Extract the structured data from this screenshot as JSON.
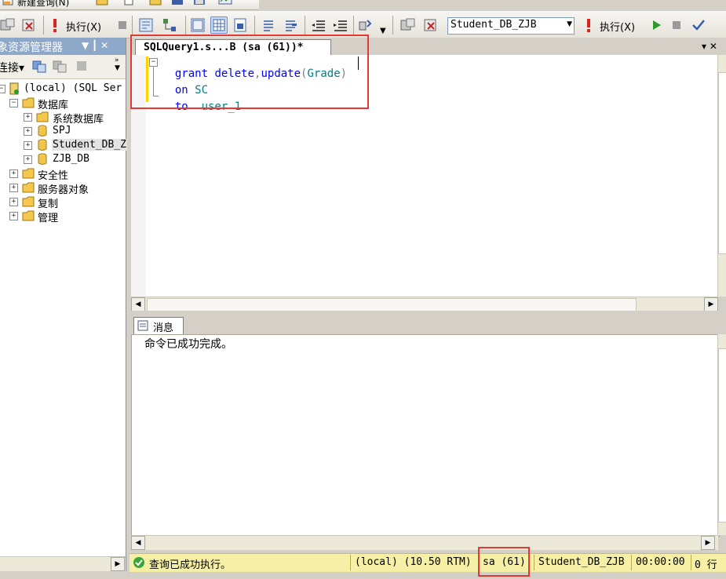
{
  "toolbar_top": {
    "new_query_label": "新建查询(N)"
  },
  "toolbar_main": {
    "execute_label_left": "执行(X)",
    "database_select_value": "Student_DB_ZJB",
    "execute_label_right": "执行(X)"
  },
  "object_explorer": {
    "title": "象资源管理器",
    "title_pin": "▼ ┃ ✕",
    "connect_label": "连接▾",
    "tree": [
      {
        "label": "(local) (SQL Ser",
        "level": 0
      },
      {
        "label": "数据库",
        "level": 1
      },
      {
        "label": "系统数据库",
        "level": 2
      },
      {
        "label": "SPJ",
        "level": 2
      },
      {
        "label": "Student_DB_Z",
        "level": 2
      },
      {
        "label": "ZJB_DB",
        "level": 2
      },
      {
        "label": "安全性",
        "level": 1
      },
      {
        "label": "服务器对象",
        "level": 1
      },
      {
        "label": "复制",
        "level": 1
      },
      {
        "label": "管理",
        "level": 1
      }
    ]
  },
  "editor": {
    "tab_title": "SQLQuery1.s...B (sa (61))*",
    "tab_strip_buttons": "▾ ✕",
    "lines": [
      {
        "kw1": "grant",
        "kw2": "delete",
        "p1": ",",
        "kw3": "update",
        "p2": "(",
        "col": "Grade",
        "p3": ")"
      },
      {
        "kw1": "on",
        "obj": "SC"
      },
      {
        "kw1": "to",
        "obj": "user_1"
      }
    ]
  },
  "results": {
    "tab_label": "消息",
    "message": "命令已成功完成。"
  },
  "status_bar": {
    "status_text": "查询已成功执行。",
    "server": "(local) (10.50 RTM)",
    "user": "sa (61)",
    "database": "Student_DB_ZJB",
    "elapsed": "00:00:00",
    "rows": "0 行"
  },
  "colors": {
    "keyword": "#0000ff",
    "identifier": "#008080",
    "punctuation": "#808080",
    "highlight_box": "#e53935",
    "status_bar_bg": "#f6f0a6"
  }
}
